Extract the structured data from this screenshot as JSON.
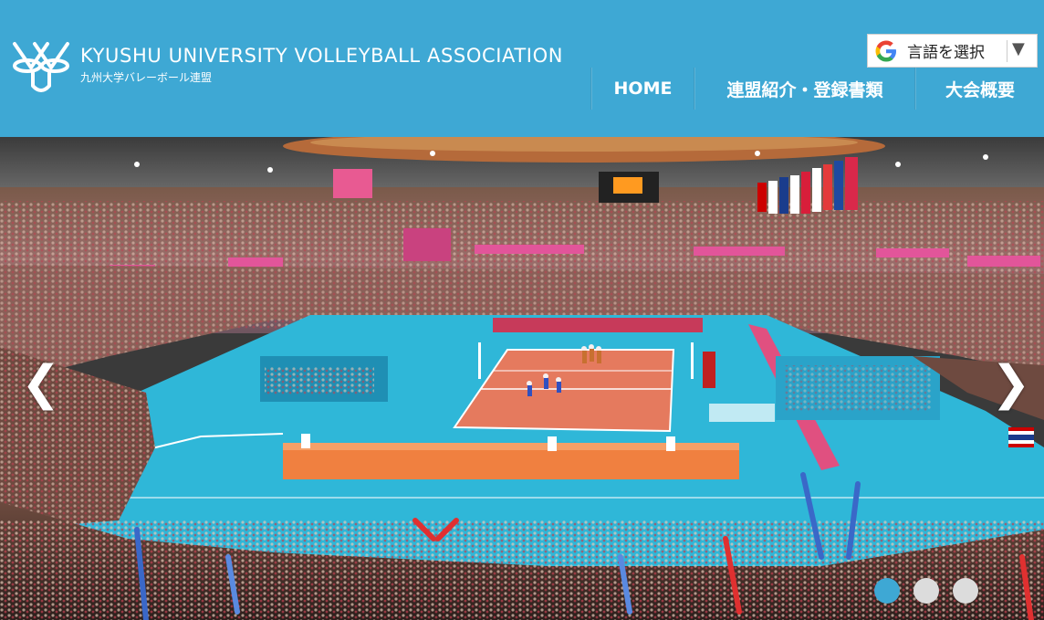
{
  "header": {
    "brand_en": "KYUSHU UNIVERSITY VOLLEYBALL ASSOCIATION",
    "brand_ja": "九州大学バレーボール連盟",
    "logo_icon": "volleyball-association-logo"
  },
  "translate": {
    "label": "言語を選択",
    "icon": "google-g-icon",
    "arrow": "▼"
  },
  "nav": {
    "items": [
      {
        "label": "HOME"
      },
      {
        "label": "連盟紹介・登録書類"
      },
      {
        "label": "大会概要"
      }
    ]
  },
  "slider": {
    "prev": "❮",
    "next": "❯",
    "dots_count": 3,
    "active_dot": 1,
    "image_icon": "volleyball-arena-photo"
  },
  "colors": {
    "header_bg": "#3ea8d4",
    "court_floor": "#2fb7d8",
    "court_center": "#e57a5e",
    "dot_active": "#3ea8d4",
    "dot_inactive": "#dcdcdc"
  }
}
